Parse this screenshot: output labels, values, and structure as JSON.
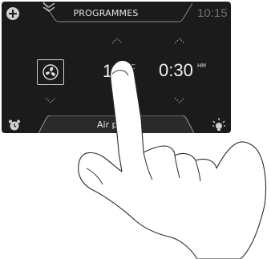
{
  "header": {
    "title": "PROGRAMMES",
    "clock": "10:15"
  },
  "controls": {
    "temperature_value": "180",
    "temperature_unit": "°C",
    "time_value": "0:30",
    "time_unit": "HM"
  },
  "footer": {
    "mode_label": "Air pulsé"
  },
  "icons": {
    "add": "plus-circle-icon",
    "menu": "double-chevron-down-icon",
    "mode": "fan-icon",
    "alarm": "alarm-clock-icon",
    "light": "oven-light-icon"
  },
  "colors": {
    "screen_bg": "#1b1b1b",
    "text": "#e6e6e6",
    "clock_text": "#6d6d6d"
  }
}
